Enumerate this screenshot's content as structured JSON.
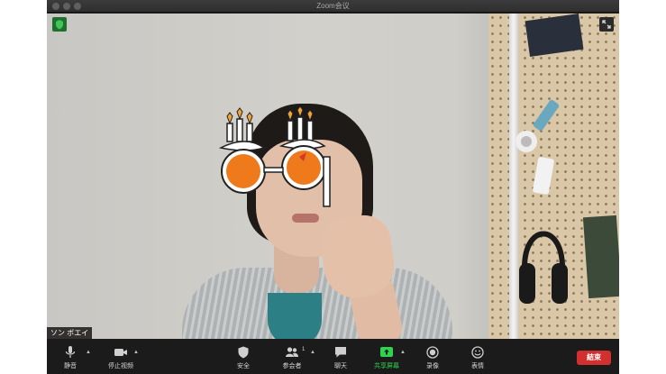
{
  "window": {
    "title": "Zoom会议"
  },
  "video": {
    "participant_name": "ソン ボエイ"
  },
  "toolbar": {
    "mute": "静音",
    "stop_video": "停止视频",
    "security": "安全",
    "participants": "参会者",
    "participant_count": "1",
    "chat": "聊天",
    "share_screen": "共享屏幕",
    "record": "录像",
    "reactions": "表情",
    "end": "結束"
  },
  "colors": {
    "share_green": "#2fd34d",
    "end_red": "#d22f2f",
    "security_badge": "#1f6f2f"
  }
}
